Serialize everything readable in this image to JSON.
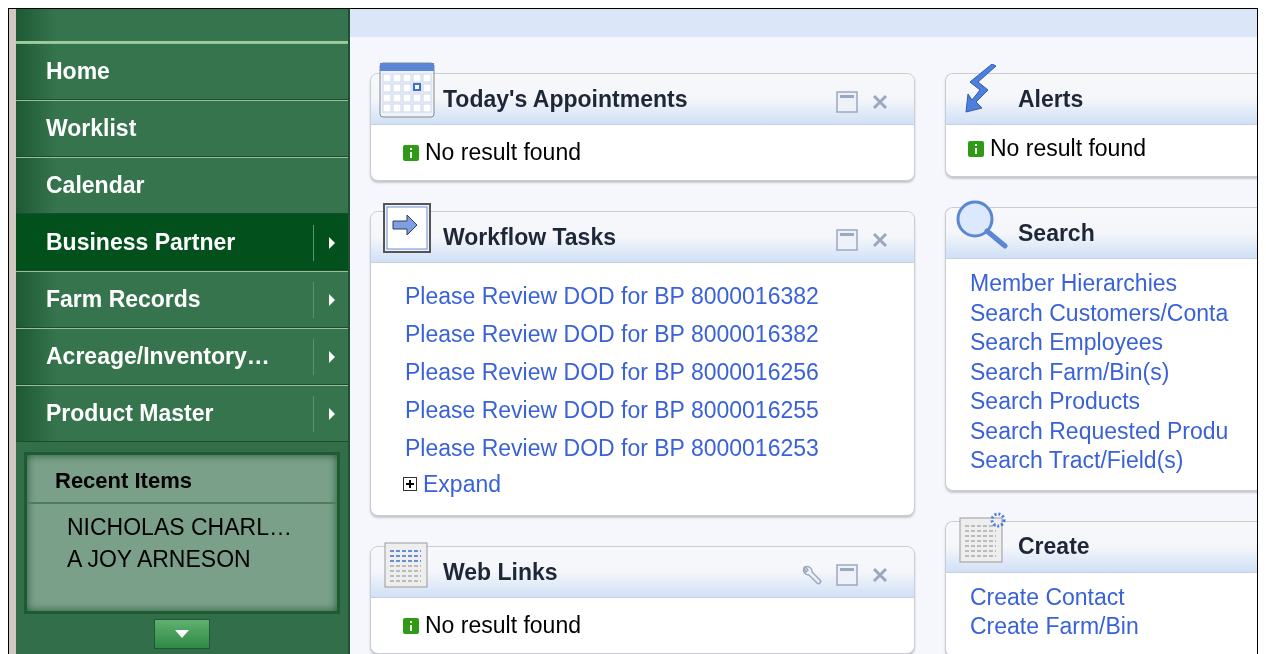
{
  "sidebar": {
    "items": [
      {
        "label": "Home",
        "selected": false,
        "submenu": false
      },
      {
        "label": "Worklist",
        "selected": false,
        "submenu": false
      },
      {
        "label": "Calendar",
        "selected": false,
        "submenu": false
      },
      {
        "label": "Business Partner",
        "selected": true,
        "submenu": true
      },
      {
        "label": "Farm Records",
        "selected": false,
        "submenu": true
      },
      {
        "label": "Acreage/Inventory…",
        "selected": false,
        "submenu": true
      },
      {
        "label": "Product Master",
        "selected": false,
        "submenu": true
      }
    ],
    "recent_items": {
      "title": "Recent Items",
      "items": [
        "NICHOLAS CHARL…",
        "A JOY ARNESON"
      ]
    }
  },
  "columns": [
    [
      {
        "title": "Today's Appointments",
        "body": {
          "kind": "message",
          "text": "No result found"
        }
      },
      {
        "title": "Workflow Tasks",
        "body": {
          "kind": "links",
          "links": [
            "Please Review DOD for BP 8000016382",
            "Please Review DOD for BP 8000016382",
            "Please Review DOD for BP 8000016256",
            "Please Review DOD for BP 8000016255",
            "Please Review DOD for BP 8000016253"
          ],
          "expand": "Expand"
        }
      },
      {
        "title": "Web Links",
        "body": {
          "kind": "message",
          "text": "No result found"
        }
      }
    ],
    [
      {
        "title": "Alerts",
        "body": {
          "kind": "message",
          "text": "No result found"
        }
      },
      {
        "title": "Search",
        "body": {
          "kind": "links",
          "links": [
            "Member Hierarchies",
            "Search Customers/Conta",
            "Search Employees",
            "Search Farm/Bin(s)",
            "Search Products",
            "Search Requested Produ",
            "Search Tract/Field(s)"
          ]
        }
      },
      {
        "title": "Create",
        "body": {
          "kind": "links",
          "links": [
            "Create Contact",
            "Create Farm/Bin"
          ]
        }
      }
    ]
  ]
}
